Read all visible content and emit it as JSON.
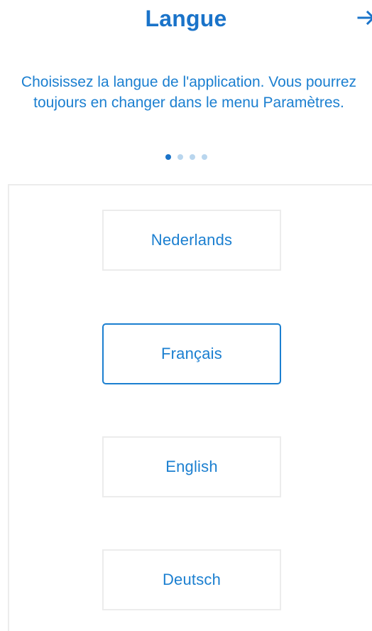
{
  "header": {
    "title": "Langue",
    "next_icon": "arrow-right-icon"
  },
  "intro": {
    "text": "Choisissez la langue de l'application. Vous pourrez toujours en changer dans le menu Paramètres."
  },
  "pagination": {
    "total": 4,
    "current": 1
  },
  "languages": [
    {
      "label": "Nederlands",
      "selected": false
    },
    {
      "label": "Français",
      "selected": true
    },
    {
      "label": "English",
      "selected": false
    },
    {
      "label": "Deutsch",
      "selected": false
    }
  ],
  "colors": {
    "accent": "#1a73c9",
    "text_accent": "#1b7fd0",
    "border": "#ececec",
    "dot_inactive": "#b9d6ee"
  }
}
